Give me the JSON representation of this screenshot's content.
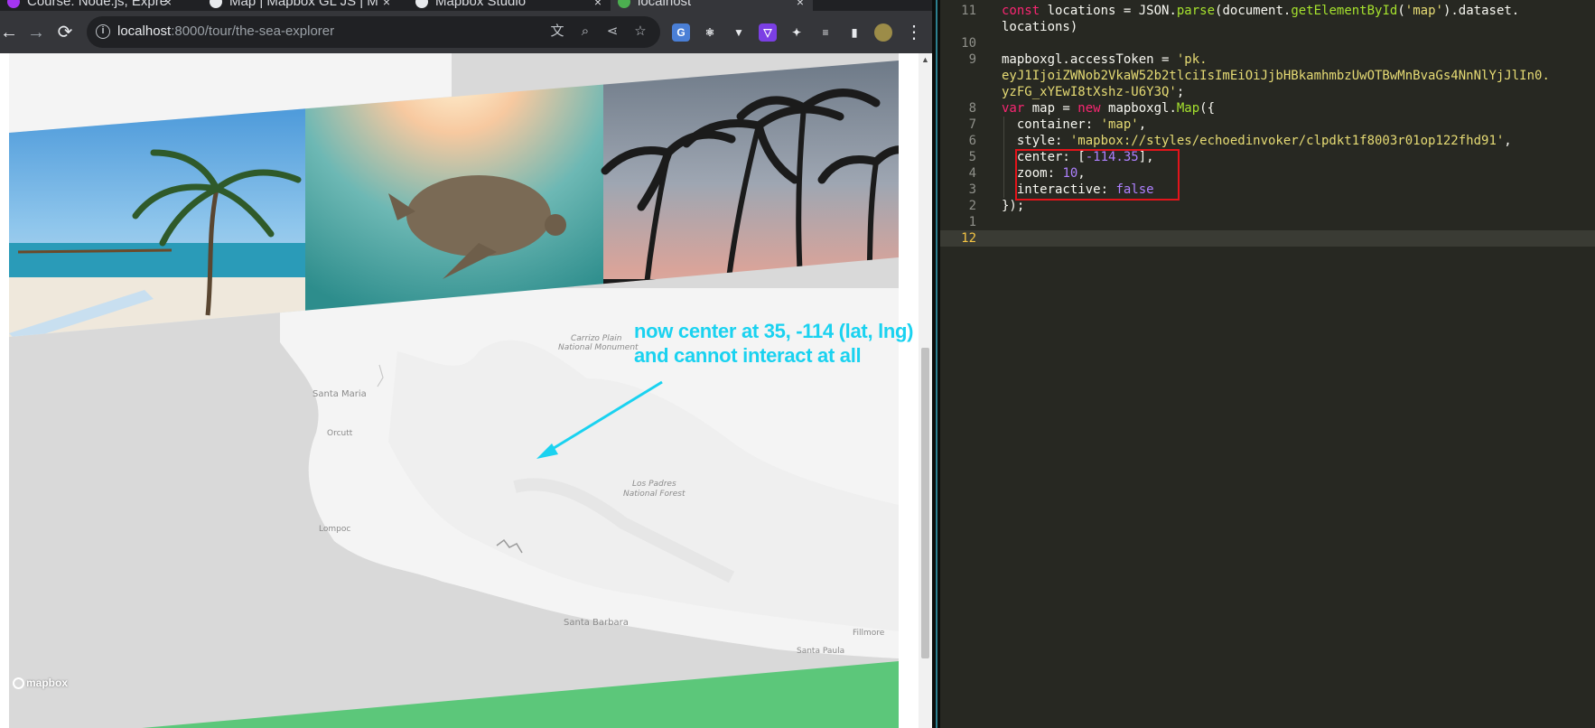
{
  "browser": {
    "tabs": [
      {
        "title": "Course: Node.js, Expre",
        "close": "×"
      },
      {
        "title": "Map | Mapbox GL JS | M",
        "close": "×"
      },
      {
        "title": "Mapbox Studio",
        "close": "×"
      },
      {
        "title": "localhost",
        "close": "×"
      }
    ],
    "url_host": "localhost",
    "url_path": ":8000/tour/the-sea-explorer",
    "nav": {
      "back": "←",
      "forward": "→",
      "reload": "⟳"
    },
    "menu_icon": "⋮"
  },
  "map": {
    "labels": {
      "santa_maria": "Santa Maria",
      "orcutt": "Orcutt",
      "lompoc": "Lompoc",
      "los_padres": "Los Padres",
      "national_forest": "National Forest",
      "carrizo": "Carrizo Plain",
      "national_monument": "National Monument",
      "santa_barbara": "Santa Barbara",
      "fillmore": "Fillmore",
      "santa_paula": "Santa Paula"
    },
    "logo": "mapbox"
  },
  "annotation": {
    "line1": "now center at 35, -114 (lat, lng)",
    "line2": "and cannot interact at all",
    "color": "#1ad2f0"
  },
  "editor": {
    "lines": [
      {
        "num": "11",
        "tokens": [
          [
            "k",
            "const "
          ],
          [
            "p",
            "locations = JSON."
          ],
          [
            "f",
            "parse"
          ],
          [
            "p",
            "(document."
          ],
          [
            "f",
            "getElementById"
          ],
          [
            "p",
            "("
          ],
          [
            "s",
            "'map'"
          ],
          [
            "p",
            ").dataset."
          ]
        ]
      },
      {
        "num": "",
        "tokens": [
          [
            "p",
            "locations)"
          ]
        ]
      },
      {
        "num": "10",
        "tokens": []
      },
      {
        "num": "9",
        "tokens": [
          [
            "p",
            "mapboxgl.accessToken = "
          ],
          [
            "s",
            "'pk."
          ]
        ]
      },
      {
        "num": "",
        "tokens": [
          [
            "s",
            "eyJ1IjoiZWNob2VkaW52b2tlciIsImEiOiJjbHBkamhmbzUwOTBwMnBvaGs4NnNlYjJlIn0."
          ]
        ]
      },
      {
        "num": "",
        "tokens": [
          [
            "s",
            "yzFG_xYEwI8tXshz-U6Y3Q'"
          ],
          [
            "p",
            ";"
          ]
        ]
      },
      {
        "num": "8",
        "tokens": [
          [
            "k",
            "var "
          ],
          [
            "p",
            "map = "
          ],
          [
            "k",
            "new "
          ],
          [
            "p",
            "mapboxgl."
          ],
          [
            "f",
            "Map"
          ],
          [
            "p",
            "({"
          ]
        ]
      },
      {
        "num": "7",
        "tokens": [
          [
            "p",
            "  container: "
          ],
          [
            "s",
            "'map'"
          ],
          [
            "p",
            ","
          ]
        ]
      },
      {
        "num": "6",
        "tokens": [
          [
            "p",
            "  style: "
          ],
          [
            "s",
            "'mapbox://styles/echoedinvoker/clpdkt1f8003r01op122fhd91'"
          ],
          [
            "p",
            ","
          ]
        ]
      },
      {
        "num": "5",
        "tokens": [
          [
            "p",
            "  center: ["
          ],
          [
            "n",
            "-114.35"
          ],
          [
            "p",
            "],"
          ]
        ]
      },
      {
        "num": "4",
        "tokens": [
          [
            "p",
            "  zoom: "
          ],
          [
            "n",
            "10"
          ],
          [
            "p",
            ","
          ]
        ]
      },
      {
        "num": "3",
        "tokens": [
          [
            "p",
            "  interactive: "
          ],
          [
            "n",
            "false"
          ]
        ]
      },
      {
        "num": "2",
        "tokens": [
          [
            "p",
            "});"
          ]
        ]
      },
      {
        "num": "1",
        "tokens": []
      },
      {
        "num": "12",
        "tokens": [],
        "current": true
      }
    ]
  },
  "colors": {
    "highlight_box": "#e3141b",
    "green_band": "#5cc77a"
  }
}
